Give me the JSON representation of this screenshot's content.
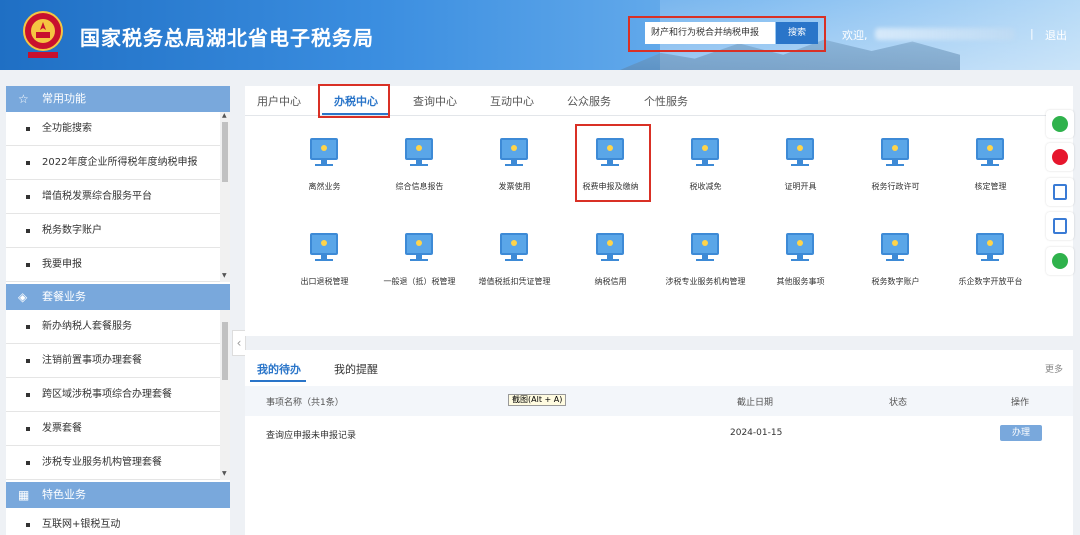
{
  "header": {
    "title": "国家税务总局湖北省电子税务局",
    "search_value": "财产和行为税合并纳税申报",
    "search_button": "搜索",
    "welcome": "欢迎,",
    "separator": "|",
    "logout": "退出"
  },
  "sidebar": {
    "sections": [
      {
        "title": "常用功能",
        "icon": "star-icon",
        "items": [
          "全功能搜索",
          "2022年度企业所得税年度纳税申报",
          "增值税发票综合服务平台",
          "税务数字账户",
          "我要申报"
        ]
      },
      {
        "title": "套餐业务",
        "icon": "stack-icon",
        "items": [
          "新办纳税人套餐服务",
          "注销前置事项办理套餐",
          "跨区域涉税事项综合办理套餐",
          "发票套餐",
          "涉税专业服务机构管理套餐"
        ]
      },
      {
        "title": "特色业务",
        "icon": "grid-icon",
        "items": [
          "互联网+银税互动"
        ]
      }
    ]
  },
  "tabs": [
    "用户中心",
    "办税中心",
    "查询中心",
    "互动中心",
    "公众服务",
    "个性服务"
  ],
  "active_tab": "办税中心",
  "services": [
    "离然业务",
    "综合信息报告",
    "发票使用",
    "税费申报及缴纳",
    "税收减免",
    "证明开具",
    "税务行政许可",
    "核定管理",
    "出口退税管理",
    "一般退（抵）税管理",
    "增值税抵扣凭证管理",
    "纳税信用",
    "涉税专业服务机构管理",
    "其他服务事项",
    "税务数字账户",
    "乐企数字开放平台"
  ],
  "todo": {
    "tabs": [
      "我的待办",
      "我的提醒"
    ],
    "more": "更多",
    "headers": {
      "name": "事项名称（共1条）",
      "deadline": "截止日期",
      "status": "状态",
      "action": "操作"
    },
    "tooltip": "截图(Alt + A)",
    "rows": [
      {
        "name": "查询应申报未申报记录",
        "deadline": "2024-01-15",
        "status": "",
        "action": "办理"
      }
    ]
  },
  "colors": {
    "accent": "#2a75c9",
    "highlight": "#d93025",
    "sidebar_head": "#79a8dc"
  }
}
